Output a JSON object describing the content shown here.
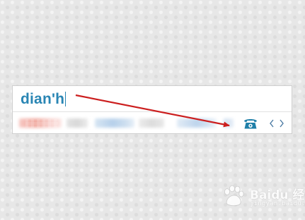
{
  "ime": {
    "composition_text": "dian'h",
    "text_color": "#2a86b4",
    "candidates_blurred": true,
    "candidate_icon": "telephone-icon",
    "prev_icon": "chevron-left-icon",
    "next_icon": "chevron-right-icon"
  },
  "annotation": {
    "arrow_color": "#cc1f1f",
    "target": "telephone-icon"
  },
  "watermark": {
    "brand": "Baidu 经验",
    "url": "jingyan.baidu.com"
  }
}
